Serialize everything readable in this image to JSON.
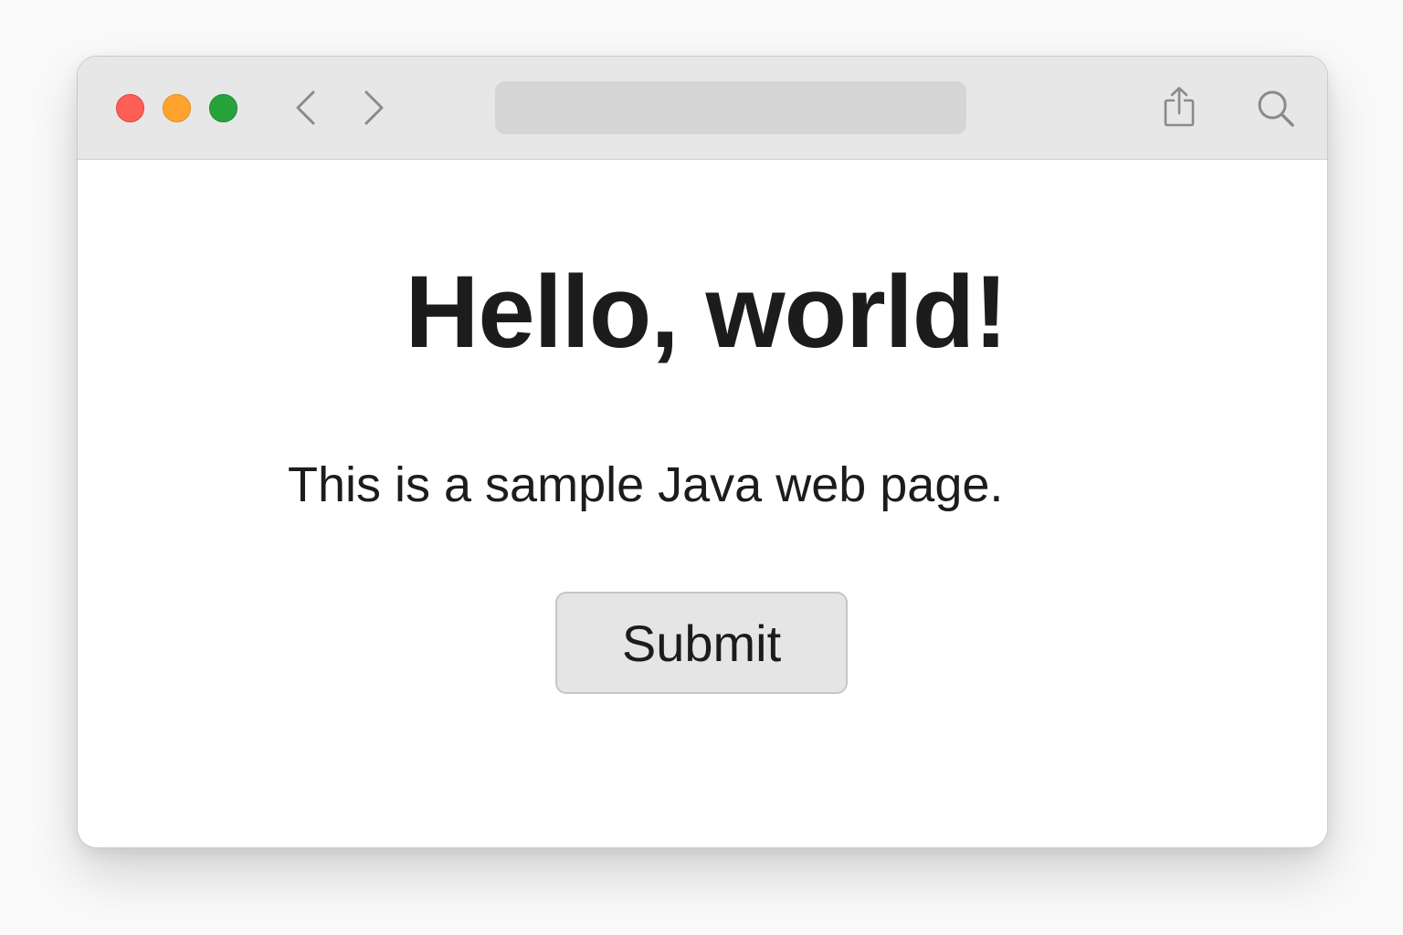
{
  "window": {
    "traffic_lights": {
      "close_color": "#fd5f57",
      "minimize_color": "#fea42e",
      "zoom_color": "#27a33c"
    }
  },
  "toolbar": {
    "back_icon": "chevron-left-icon",
    "forward_icon": "chevron-right-icon",
    "address_value": "",
    "share_icon": "share-icon",
    "search_icon": "search-icon"
  },
  "page": {
    "heading": "Hello, world!",
    "paragraph": "This is a sample Java web page.",
    "submit_label": "Submit"
  }
}
